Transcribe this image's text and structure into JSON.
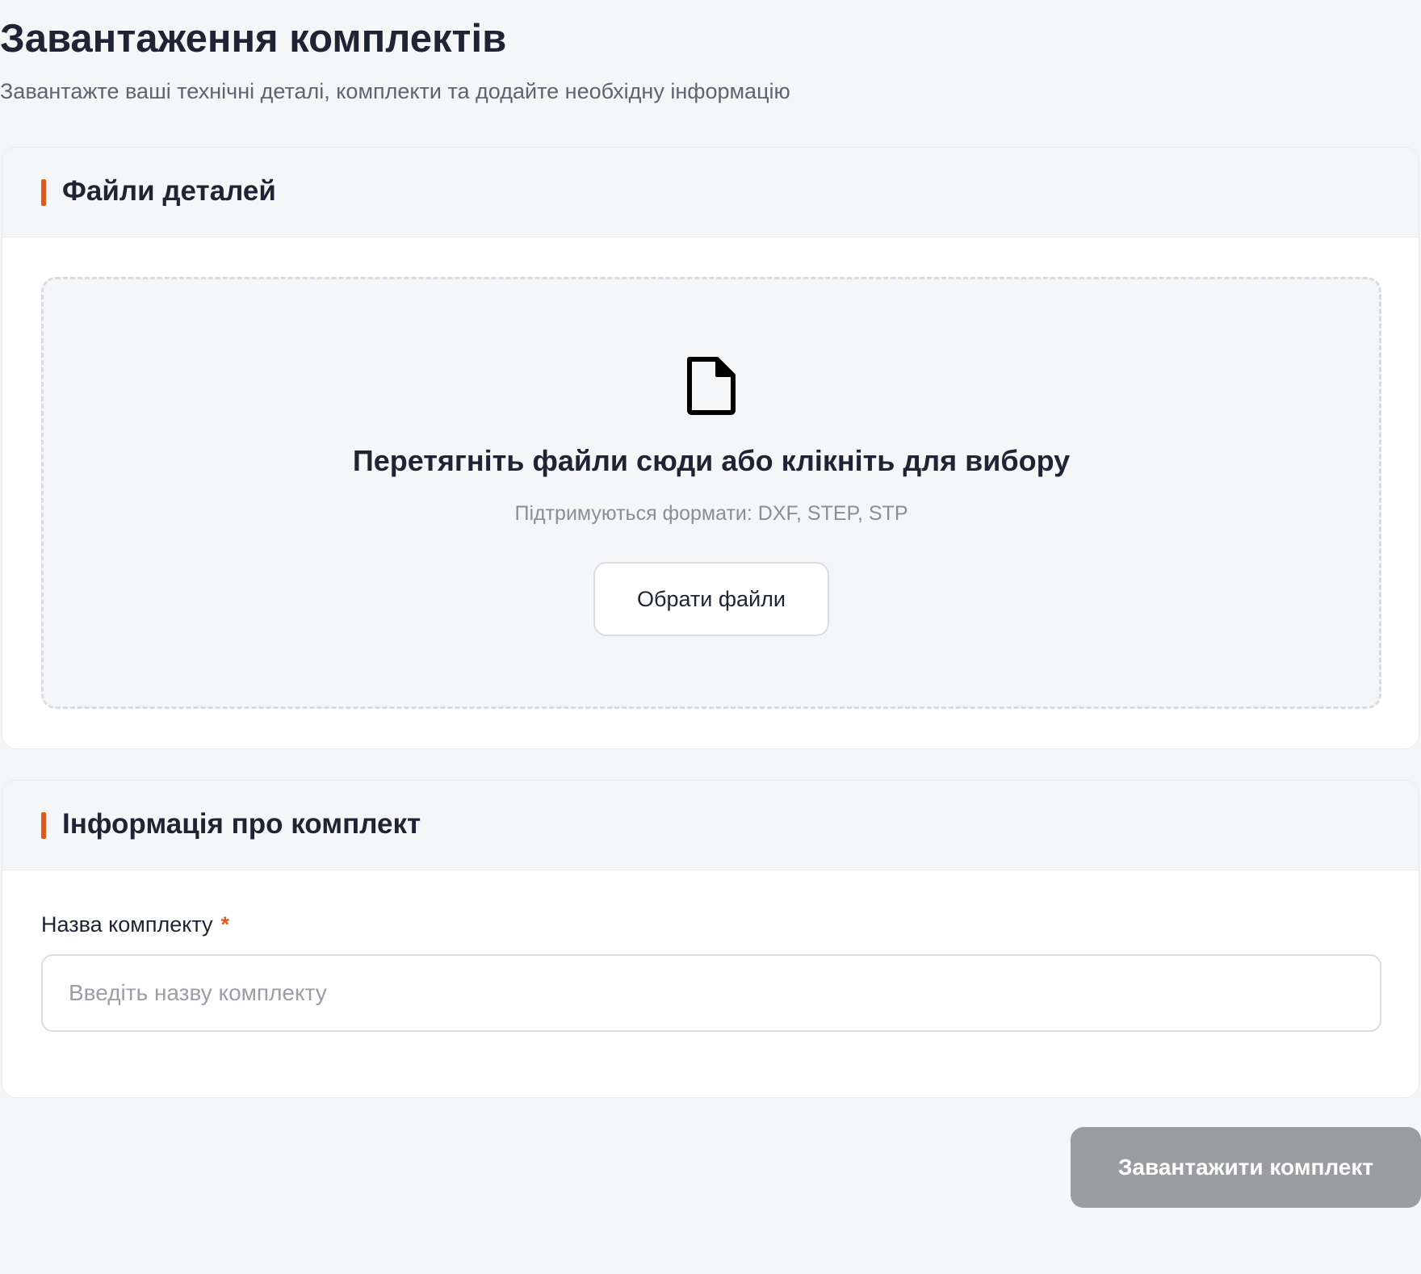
{
  "header": {
    "title": "Завантаження комплектів",
    "subtitle": "Завантажте ваші технічні деталі, комплекти та додайте необхідну інформацію"
  },
  "files_section": {
    "title": "Файли деталей",
    "dropzone": {
      "icon": "file-icon",
      "title": "Перетягніть файли сюди або клікніть для вибору",
      "formats": "Підтримуються формати: DXF, STEP, STP",
      "choose_button_label": "Обрати файли"
    }
  },
  "info_section": {
    "title": "Інформація про комплект",
    "name_field": {
      "label": "Назва комплекту",
      "required_marker": "*",
      "value": "",
      "placeholder": "Введіть назву комплекту"
    }
  },
  "actions": {
    "submit_label": "Завантажити комплект",
    "submit_disabled": true
  },
  "colors": {
    "accent": "#e05a1c",
    "background": "#f5f6f8",
    "text_primary": "#1e2433",
    "text_muted": "#8a8e97",
    "button_disabled": "#9a9c9f"
  }
}
